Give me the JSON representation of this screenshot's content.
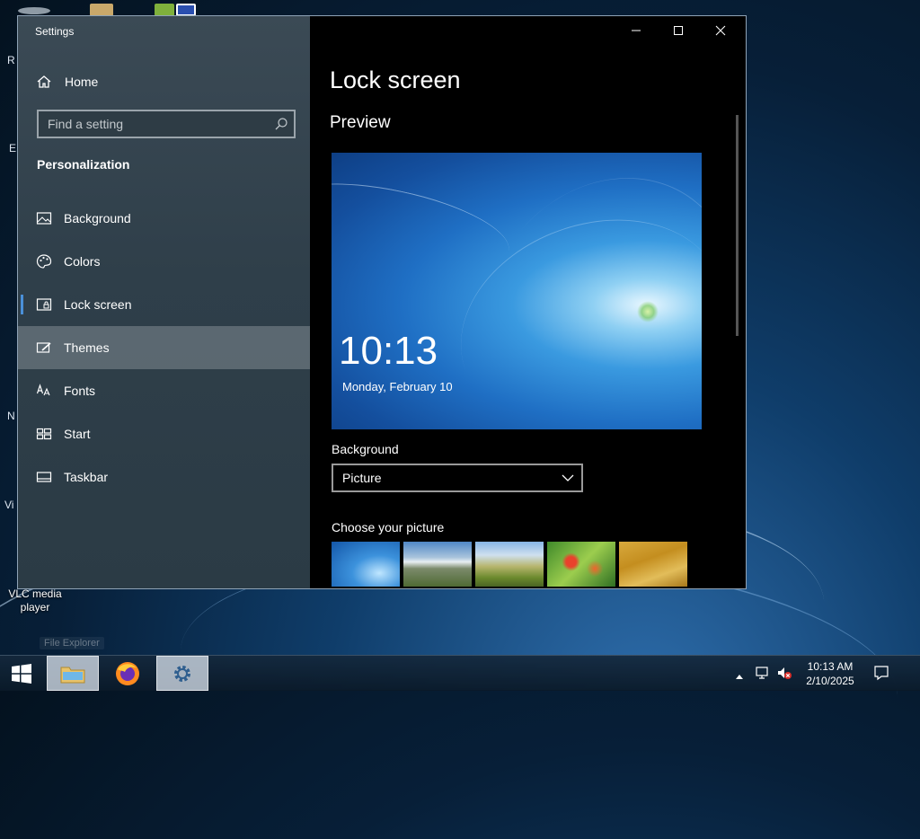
{
  "desktop": {
    "vlc_label": "VLC media player",
    "ghost_label": "File Explorer",
    "edge_letters": [
      "R",
      "E",
      "N",
      "Vi"
    ]
  },
  "window": {
    "title": "Settings",
    "home_label": "Home",
    "search_placeholder": "Find a setting",
    "section_title": "Personalization",
    "nav_items": [
      {
        "label": "Background",
        "icon": "picture-icon"
      },
      {
        "label": "Colors",
        "icon": "palette-icon"
      },
      {
        "label": "Lock screen",
        "icon": "lock-screen-icon"
      },
      {
        "label": "Themes",
        "icon": "brush-icon"
      },
      {
        "label": "Fonts",
        "icon": "font-icon"
      },
      {
        "label": "Start",
        "icon": "start-icon"
      },
      {
        "label": "Taskbar",
        "icon": "taskbar-icon"
      }
    ],
    "selected_item": "Lock screen",
    "hovered_item": "Themes"
  },
  "content": {
    "page_title": "Lock screen",
    "preview_heading": "Preview",
    "preview_time": "10:13",
    "preview_date": "Monday, February 10",
    "background_label": "Background",
    "background_value": "Picture",
    "choose_label": "Choose your picture"
  },
  "taskbar": {
    "time": "10:13 AM",
    "date": "2/10/2025"
  },
  "colors": {
    "accent": "#4a90d9",
    "sidebar": "#33434e",
    "content_bg": "#000000"
  }
}
